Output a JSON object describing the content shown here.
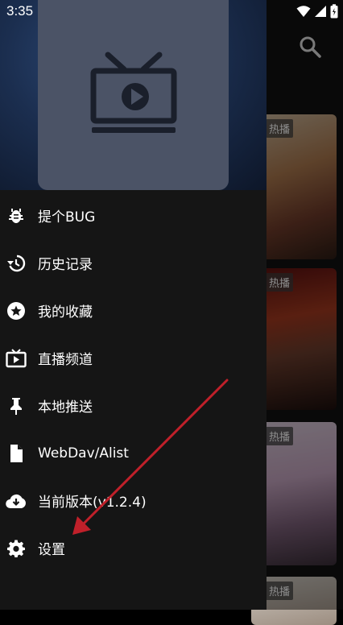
{
  "status_bar": {
    "time": "3:35"
  },
  "drawer": {
    "menu_items": [
      {
        "label": "提个BUG",
        "icon": "bug-icon"
      },
      {
        "label": "历史记录",
        "icon": "history-icon"
      },
      {
        "label": "我的收藏",
        "icon": "star-icon"
      },
      {
        "label": "直播频道",
        "icon": "live-tv-icon"
      },
      {
        "label": "本地推送",
        "icon": "pin-icon"
      },
      {
        "label": "WebDav/Alist",
        "icon": "file-icon"
      },
      {
        "label": "当前版本(v1.2.4)",
        "icon": "cloud-download-icon"
      },
      {
        "label": "设置",
        "icon": "gear-icon"
      }
    ]
  },
  "content": {
    "cards": [
      {
        "badge": "热播"
      },
      {
        "badge": "热播"
      },
      {
        "badge": "热播"
      },
      {
        "badge": "热播"
      }
    ]
  },
  "colors": {
    "drawer_bg": "#151515",
    "annotation_arrow": "#c0202a"
  }
}
